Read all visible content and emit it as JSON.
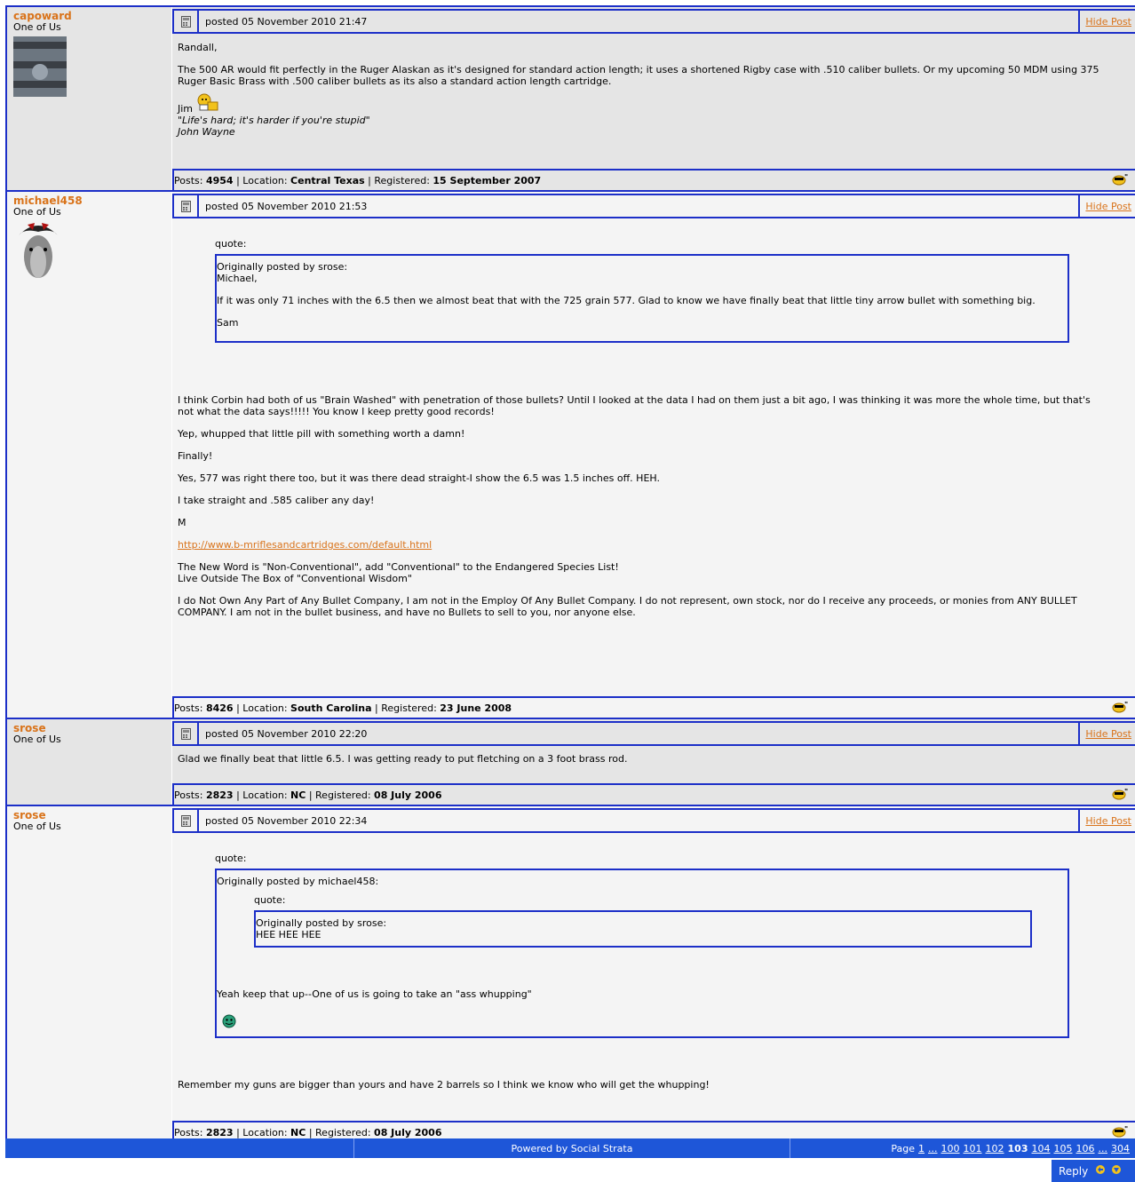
{
  "posts": [
    {
      "author": "capoward",
      "rank": "One of Us",
      "posted": "posted 05 November 2010 21:47",
      "hide": "Hide Post",
      "paras": [
        "Randall,",
        "The 500 AR would fit perfectly in the Ruger Alaskan as it's designed for standard action length; it uses a shortened Rigby case with .510 caliber bullets. Or my upcoming 50 MDM using 375 Ruger Basic Brass with .500 caliber bullets as its also a standard action length cartridge."
      ],
      "sig_name": "Jim",
      "sig_quote": "\"Life's hard; it's harder if you're stupid\"",
      "sig_author": "John Wayne",
      "footer": {
        "posts_label": "Posts:",
        "posts": "4954",
        "sep1": "|",
        "loc_label": "Location:",
        "loc": "Central Texas",
        "sep2": "|",
        "reg_label": "Registered:",
        "reg": "15 September 2007"
      }
    },
    {
      "author": "michael458",
      "rank": "One of Us",
      "posted": "posted 05 November 2010 21:53",
      "hide": "Hide Post",
      "quote_label": "quote:",
      "quote_by": "Originally posted by srose:",
      "quote_lines": [
        "Michael,",
        "If it was only 71 inches with the 6.5 then we almost beat that with the 725 grain 577. Glad to know we have finally beat that little tiny arrow bullet with something big.",
        "Sam"
      ],
      "paras": [
        "I think Corbin had both of us \"Brain Washed\" with penetration of those bullets? Until I looked at the data I had on them just a bit ago, I was thinking it was more the whole time, but that's not what the data says!!!!! You know I keep pretty good records!",
        "Yep, whupped that little pill with something worth a damn!",
        "Finally!",
        "Yes, 577 was right there too, but it was there dead straight-I show the 6.5 was 1.5 inches off. HEH.",
        "I take straight and .585 caliber any day!",
        "M"
      ],
      "link": "http://www.b-mriflesandcartridges.com/default.html",
      "sig1": "The New Word is \"Non-Conventional\", add \"Conventional\" to the Endangered Species List!",
      "sig2": "Live Outside The Box of \"Conventional Wisdom\"",
      "sig3": "I do Not Own Any Part of Any Bullet Company, I am not in the Employ Of Any Bullet Company. I do not represent, own stock, nor do I receive any proceeds, or monies from ANY BULLET COMPANY. I am not in the bullet business, and have no Bullets to sell to you, nor anyone else.",
      "footer": {
        "posts_label": "Posts:",
        "posts": "8426",
        "sep1": "|",
        "loc_label": "Location:",
        "loc": "South Carolina",
        "sep2": "|",
        "reg_label": "Registered:",
        "reg": "23 June 2008"
      }
    },
    {
      "author": "srose",
      "rank": "One of Us",
      "posted": "posted 05 November 2010 22:20",
      "hide": "Hide Post",
      "paras": [
        "Glad we finally beat that little 6.5. I was getting ready to put fletching on a 3 foot brass rod."
      ],
      "footer": {
        "posts_label": "Posts:",
        "posts": "2823",
        "sep1": "|",
        "loc_label": "Location:",
        "loc": "NC",
        "sep2": "|",
        "reg_label": "Registered:",
        "reg": "08 July 2006"
      }
    },
    {
      "author": "srose",
      "rank": "One of Us",
      "posted": "posted 05 November 2010 22:34",
      "hide": "Hide Post",
      "quote_label": "quote:",
      "quote_by": "Originally posted by michael458:",
      "inner_quote_label": "quote:",
      "inner_quote_by": "Originally posted by srose:",
      "inner_quote_text": "HEE HEE HEE",
      "quote_text": "Yeah keep that up--One of us is going to take an \"ass whupping\"",
      "paras": [
        "Remember my guns are bigger than yours and have 2 barrels so I think we know who will get the whupping!"
      ],
      "footer": {
        "posts_label": "Posts:",
        "posts": "2823",
        "sep1": "|",
        "loc_label": "Location:",
        "loc": "NC",
        "sep2": "|",
        "reg_label": "Registered:",
        "reg": "08 July 2006"
      }
    }
  ],
  "status": {
    "powered": "Powered by Social Strata",
    "page_label": "Page",
    "pages": [
      "1",
      "...",
      "100",
      "101",
      "102",
      "103",
      "104",
      "105",
      "106",
      "...",
      "304"
    ],
    "current": "103"
  },
  "reply": "Reply",
  "colors": {
    "accent": "#1c2fc8",
    "link": "#d9731a",
    "status_bg": "#1e56d8"
  }
}
